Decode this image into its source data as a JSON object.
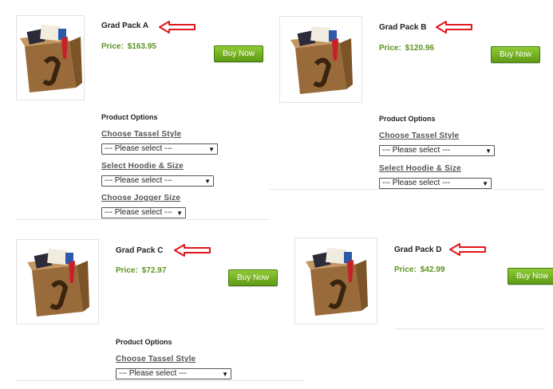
{
  "products": [
    {
      "title": "Grad Pack A",
      "price_label": "Price:",
      "price": "$163.95",
      "button": "Buy Now"
    },
    {
      "title": "Grad Pack B",
      "price_label": "Price:",
      "price": "$120.96",
      "button": "Buy Now"
    },
    {
      "title": "Grad Pack C",
      "price_label": "Price:",
      "price": "$72.97",
      "button": "Buy Now"
    },
    {
      "title": "Grad Pack D",
      "price_label": "Price:",
      "price": "$42.99",
      "button": "Buy Now"
    }
  ],
  "options": {
    "heading": "Product Options",
    "tassel_label": "Choose Tassel Style",
    "hoodie_label": "Select Hoodie & Size",
    "jogger_label": "Choose Jogger Size",
    "placeholder": "--- Please select ---"
  },
  "icons": {
    "arrow": "red-left-arrow-icon",
    "thumb": "grad-pack-box-image"
  },
  "colors": {
    "price": "#5b9422",
    "arrow": "#e3161c",
    "button": "#6faa1e"
  }
}
